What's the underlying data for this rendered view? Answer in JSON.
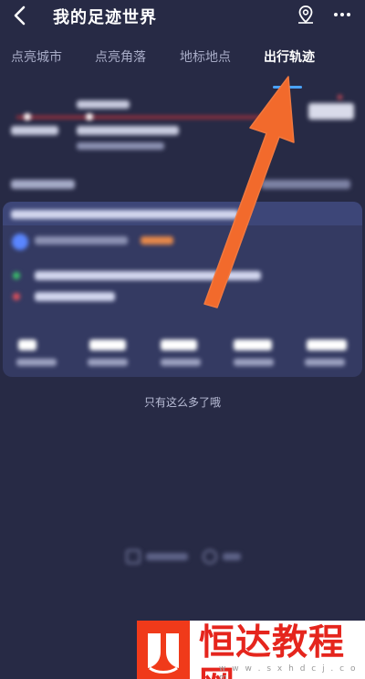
{
  "header": {
    "title": "我的足迹世界",
    "back_icon": "chevron-left-icon",
    "location_icon": "location-pin-icon",
    "more_icon": "more-horizontal-icon"
  },
  "tabs": [
    {
      "label": "点亮城市",
      "active": false
    },
    {
      "label": "点亮角落",
      "active": false
    },
    {
      "label": "地标地点",
      "active": false
    },
    {
      "label": "出行轨迹",
      "active": true
    }
  ],
  "list": {
    "end_text": "只有这么多了哦"
  },
  "watermark": {
    "brand": "恒达教程网",
    "url": "w w w . s x h d c j . c o m"
  },
  "colors": {
    "background": "#272a45",
    "card": "#343a62",
    "accent_tab": "#4aa3ff",
    "arrow": "#f26a2c",
    "watermark_red": "#e5251d"
  }
}
